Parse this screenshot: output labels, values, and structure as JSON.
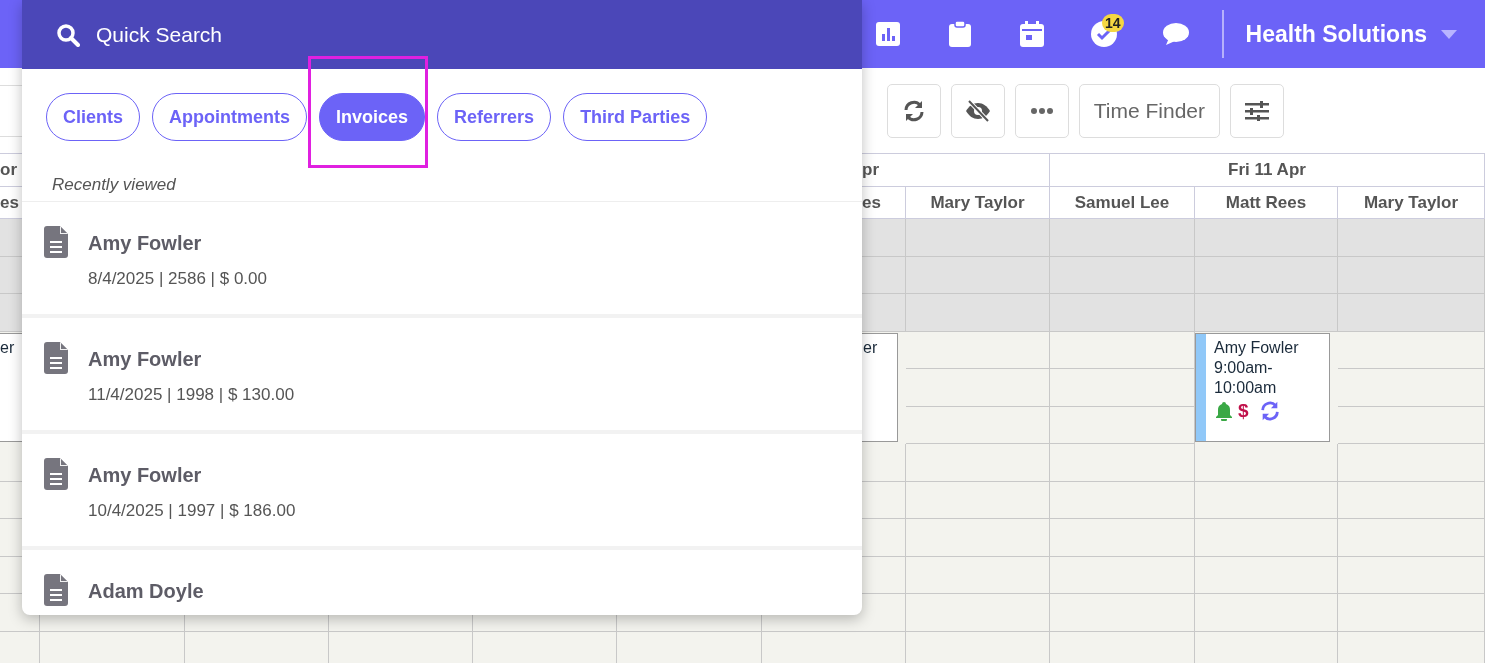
{
  "top_bar": {
    "notification_count": "14",
    "organisation": "Health Solutions"
  },
  "toolbar": {
    "buttons": [
      {
        "kind": "refresh"
      },
      {
        "kind": "hide"
      },
      {
        "kind": "more"
      },
      {
        "kind": "text",
        "label": "Time Finder"
      },
      {
        "kind": "filters"
      }
    ]
  },
  "calendar": {
    "day_headers": [
      {
        "label": "or"
      },
      {
        "label": "pr"
      },
      {
        "label": "Fri 11 Apr"
      }
    ],
    "staff_columns": [
      {
        "name": "es"
      },
      {
        "name": "es"
      },
      {
        "name": "Mary Taylor"
      },
      {
        "name": "Samuel Lee"
      },
      {
        "name": "Matt Rees"
      },
      {
        "name": "Mary Taylor"
      }
    ],
    "appointments": [
      {
        "client": "er",
        "reminder": false,
        "recurring": false
      },
      {
        "client": "er",
        "reminder": false,
        "recurring": false
      },
      {
        "client": "Amy Fowler",
        "time": "9:00am-10:00am",
        "billing_mark": "$",
        "reminder": true,
        "recurring": true
      }
    ]
  },
  "quick_search": {
    "placeholder": "Quick Search",
    "tabs": [
      {
        "label": "Clients",
        "selected": false,
        "highlighted": false
      },
      {
        "label": "Appointments",
        "selected": false,
        "highlighted": false
      },
      {
        "label": "Invoices",
        "selected": true,
        "highlighted": true
      },
      {
        "label": "Referrers",
        "selected": false,
        "highlighted": false
      },
      {
        "label": "Third Parties",
        "selected": false,
        "highlighted": false
      }
    ],
    "section_title": "Recently viewed",
    "results": [
      {
        "title": "Amy Fowler",
        "details": "8/4/2025 | 2586 | $ 0.00"
      },
      {
        "title": "Amy Fowler",
        "details": "11/4/2025 | 1998 | $ 130.00"
      },
      {
        "title": "Amy Fowler",
        "details": "10/4/2025 | 1997 | $ 186.00"
      },
      {
        "title": "Adam Doyle"
      }
    ]
  }
}
